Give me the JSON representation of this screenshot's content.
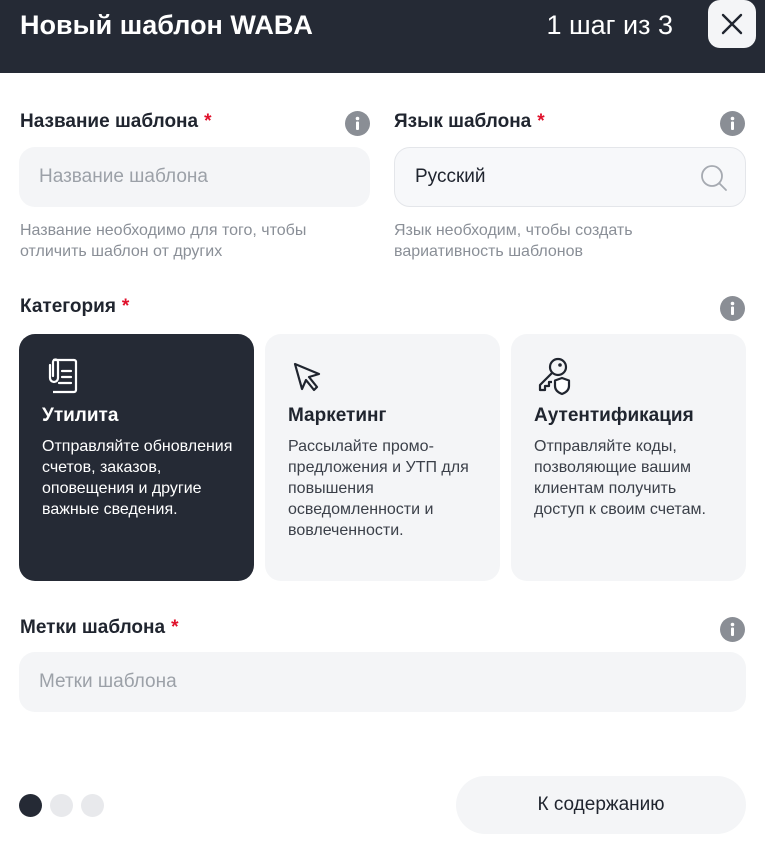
{
  "header": {
    "title": "Новый шаблон WABA",
    "step": "1 шаг из 3"
  },
  "fields": {
    "name": {
      "label": "Название шаблона",
      "required_mark": "*",
      "placeholder": "Название шаблона",
      "value": "",
      "hint": "Название необходимо для того, чтобы отличить шаблон от других"
    },
    "language": {
      "label": "Язык шаблона",
      "required_mark": "*",
      "value": "Русский",
      "hint": "Язык необходим, чтобы создать вариативность шаблонов"
    },
    "category": {
      "label": "Категория",
      "required_mark": "*",
      "selected": "utility",
      "options": [
        {
          "id": "utility",
          "icon": "document-clip-icon",
          "title": "Утилита",
          "description": "Отправляйте обновления счетов, заказов, оповещения и другие важные сведения."
        },
        {
          "id": "marketing",
          "icon": "cursor-arrow-icon",
          "title": "Маркетинг",
          "description": "Рассылайте промо-предложения и УТП для повышения осведомленности и вовлеченности."
        },
        {
          "id": "authentication",
          "icon": "key-shield-icon",
          "title": "Аутентификация",
          "description": "Отправляйте коды, позволяющие вашим клиентам получить доступ к своим счетам."
        }
      ]
    },
    "tags": {
      "label": "Метки шаблона",
      "required_mark": "*",
      "placeholder": "Метки шаблона",
      "value": ""
    }
  },
  "pagination": {
    "total": 3,
    "current": 1
  },
  "footer": {
    "next_label": "К содержанию"
  },
  "colors": {
    "dark": "#252a35",
    "required": "#e0112b",
    "field_bg": "#f4f5f7"
  }
}
